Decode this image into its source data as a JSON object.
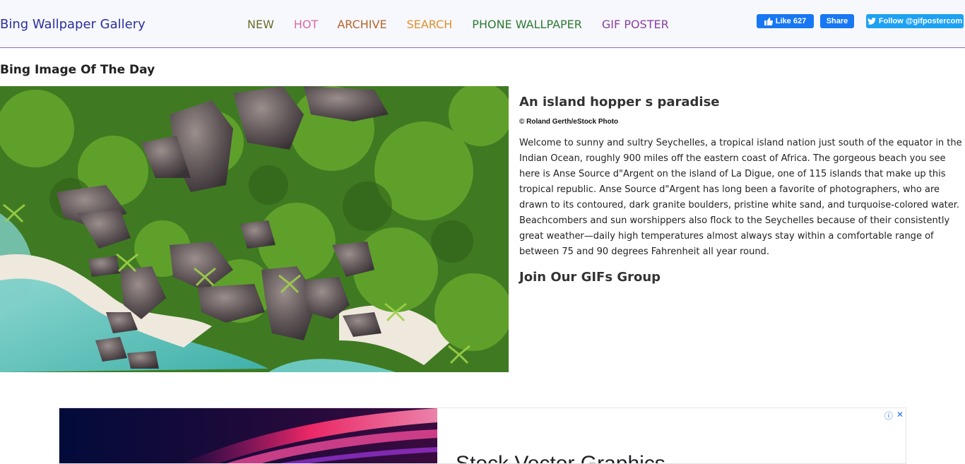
{
  "header": {
    "brand": "Bing Wallpaper Gallery",
    "nav": [
      {
        "label": "NEW",
        "color": "#6b6f2a"
      },
      {
        "label": "HOT",
        "color": "#d96aa6"
      },
      {
        "label": "ARCHIVE",
        "color": "#b5652a"
      },
      {
        "label": "SEARCH",
        "color": "#e0902f"
      },
      {
        "label": "PHONE WALLPAPER",
        "color": "#2f7a33"
      },
      {
        "label": "GIF POSTER",
        "color": "#8a3fa0"
      }
    ],
    "social": {
      "fb_like": "Like 627",
      "fb_share": "Share",
      "twitter_follow": "Follow @gifpostercom",
      "fb_color": "#1877f2",
      "twitter_color": "#1da1f2"
    }
  },
  "main": {
    "section_title": "Bing Image Of The Day",
    "image_title": "An island hopper s paradise",
    "credit": "© Roland Gerth/eStock Photo",
    "description": "Welcome to sunny and sultry Seychelles, a tropical island nation just south of the equator in the Indian Ocean, roughly 900 miles off the eastern coast of Africa. The gorgeous beach you see here is Anse Source d\"Argent on the island of La Digue, one of 115 islands that make up this tropical republic. Anse Source d\"Argent has long been a favorite of photographers, who are drawn to its contoured, dark granite boulders, pristine white sand, and turquoise-colored water. Beachcombers and sun worshippers also flock to the Seychelles because of their consistently great weather—daily high temperatures almost always stay within a comfortable range of between 75 and 90 degrees Fahrenheit all year round.",
    "join_heading": "Join Our GIFs Group"
  },
  "ad": {
    "title": "Stock Vector Graphics",
    "info_icon": "ⓘ",
    "close_icon": "✕"
  }
}
